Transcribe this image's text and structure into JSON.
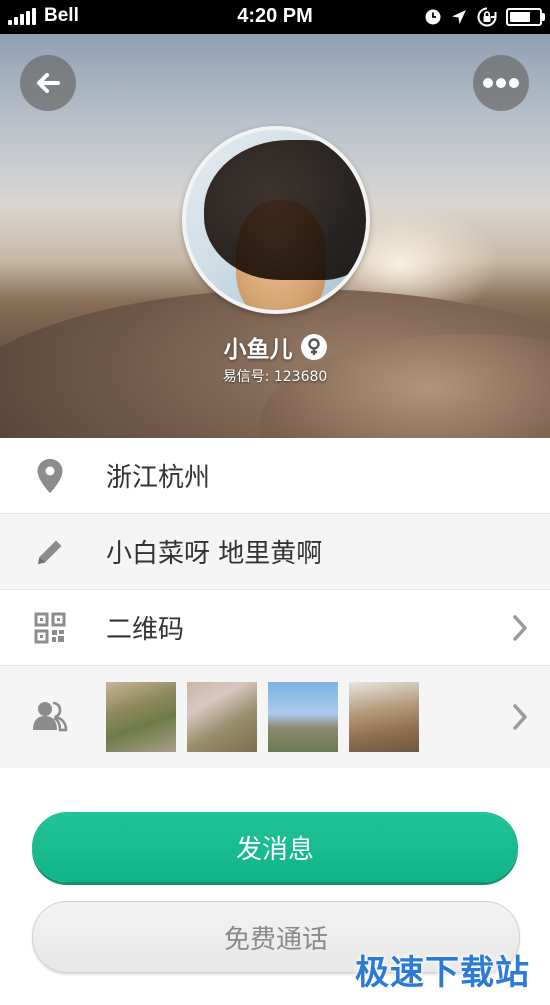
{
  "status_bar": {
    "carrier": "Bell",
    "time": "4:20 PM",
    "signal_bars": 5,
    "battery_level": 0.85,
    "icons": [
      "alarm-clock-icon",
      "location-arrow-icon",
      "rotation-lock-icon",
      "battery-icon"
    ]
  },
  "header": {
    "back_icon": "arrow-left-icon",
    "more_icon": "more-dots-icon",
    "user_name": "小鱼儿",
    "gender_icon": "female-icon",
    "user_id": "易信号: 123680"
  },
  "info_rows": [
    {
      "icon": "location-pin-icon",
      "label": "浙江杭州"
    },
    {
      "icon": "pencil-icon",
      "label": "小白菜呀 地里黄啊"
    },
    {
      "icon": "qr-code-icon",
      "label": "二维码"
    },
    {
      "icon": "contacts-icon",
      "photos": [
        "photo-1",
        "photo-2",
        "photo-3",
        "photo-4"
      ]
    }
  ],
  "buttons": {
    "send_message": "发消息",
    "free_call": "免费通话"
  },
  "watermark": "极速下载站",
  "colors": {
    "primary": "#13b88a",
    "text": "#333333",
    "icon_gray": "#8c8c8c",
    "watermark": "#2a7ad6"
  }
}
